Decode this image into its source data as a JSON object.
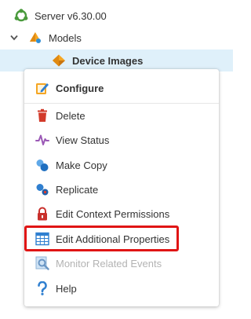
{
  "tree": {
    "server_label": "Server v6.30.00",
    "models_label": "Models",
    "device_images_label": "Device Images"
  },
  "context_menu": {
    "title": "Configure",
    "items": [
      {
        "label": "Delete",
        "icon": "trash-icon",
        "enabled": true
      },
      {
        "label": "View Status",
        "icon": "pulse-icon",
        "enabled": true
      },
      {
        "label": "Make Copy",
        "icon": "copy-icon",
        "enabled": true
      },
      {
        "label": "Replicate",
        "icon": "replicate-icon",
        "enabled": true
      },
      {
        "label": "Edit Context Permissions",
        "icon": "lock-icon",
        "enabled": true
      },
      {
        "label": "Edit Additional Properties",
        "icon": "table-icon",
        "enabled": true
      },
      {
        "label": "Monitor Related Events",
        "icon": "monitor-events-icon",
        "enabled": false
      },
      {
        "label": "Help",
        "icon": "help-icon",
        "enabled": true
      }
    ]
  },
  "highlight": {
    "target": "Edit Additional Properties",
    "color": "#e01515"
  },
  "colors": {
    "selection_bg": "#dff0fa",
    "accent_orange": "#f5a623",
    "text": "#333333",
    "disabled_text": "#b3b3b3"
  }
}
